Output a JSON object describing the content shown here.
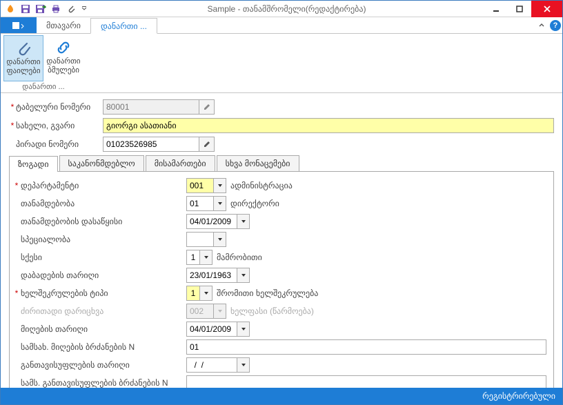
{
  "titlebar": {
    "title": "Sample - თანამშრომელი(რედაქტირება)"
  },
  "ribbon": {
    "tabs": {
      "main": "მთავარი",
      "addon": "დანართი ..."
    },
    "group_label": "დანართი ...",
    "btn_files": "დანართი ფაილები",
    "btn_links": "დანართი ბმულები"
  },
  "top_fields": {
    "tab_number_label": "ტაბელური  ნომერი",
    "tab_number_value": "80001",
    "name_label": "სახელი, გვარი",
    "name_value": "გიორგი ასათიანი",
    "personal_id_label": "პირადი ნომერი",
    "personal_id_value": "01023526985"
  },
  "inner_tabs": {
    "general": "ზოგადი",
    "legislative": "საკანონმდებლო",
    "addresses": "მისამართები",
    "other": "სხვა მონაცემები"
  },
  "general": {
    "department_label": "დეპარტამენტი",
    "department_code": "001",
    "department_name": "ადმინისტრაცია",
    "position_label": "თანამდებობა",
    "position_code": "01",
    "position_name": "დირექტორი",
    "position_start_label": "თანამდებობის დასაწყისი",
    "position_start_value": "04/01/2009",
    "speciality_label": "სპეციალობა",
    "speciality_value": "",
    "sex_label": "სქესი",
    "sex_code": "1",
    "sex_name": "მამრობითი",
    "birth_label": "დაბადების თარიღი",
    "birth_value": "23/01/1963",
    "contract_type_label": "ხელშეკრულების ტიპი",
    "contract_type_code": "1",
    "contract_type_name": "შრომითი ხელშეკრულება",
    "main_accrual_label": "ძირითადი დარიცხვა",
    "main_accrual_code": "002",
    "main_accrual_name": "ხელფასი (წარმოება)",
    "hire_date_label": "მიღების თარიღი",
    "hire_date_value": "04/01/2009",
    "hire_order_label": "სამსახ. მიღების ბრძანების N",
    "hire_order_value": "01",
    "release_date_label": "განთავისუფლების თარიღი",
    "release_date_value": "  /  /",
    "release_order_label": "სამს. განთავისუფლების ბრძანების N",
    "release_order_value": ""
  },
  "status": "რეგისტრირებული"
}
